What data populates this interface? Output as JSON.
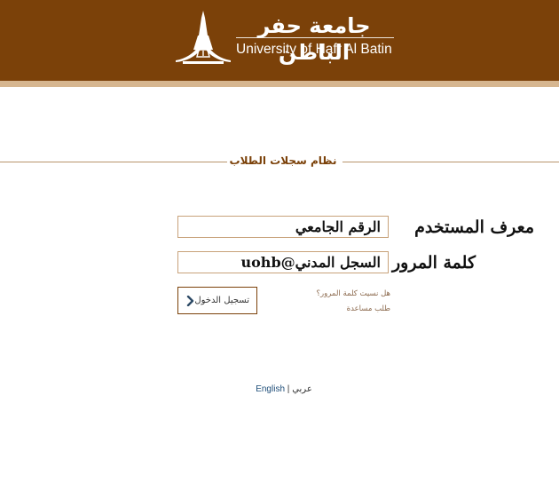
{
  "header": {
    "logo_arabic": "جامعة حفر الباطن",
    "logo_english": "University of Hafr Al Batin"
  },
  "colors": {
    "brand_brown": "#7b4109",
    "accent_tan": "#d6b690"
  },
  "section": {
    "title": "نظام سجلات الطلاب"
  },
  "form": {
    "username_label": "معرف المستخدم",
    "username_value": "الرقم الجامعي",
    "password_label": "كلمة المرور",
    "password_value": "السجل المدني@uohb",
    "login_button": "تسجيل الدخول",
    "login_icon": "chevron-right-icon",
    "forgot_password": "هل نسيت كلمة المرور؟",
    "help_request": "طلب مساعدة"
  },
  "language": {
    "english": "English",
    "separator": "|",
    "arabic": "عربي"
  }
}
